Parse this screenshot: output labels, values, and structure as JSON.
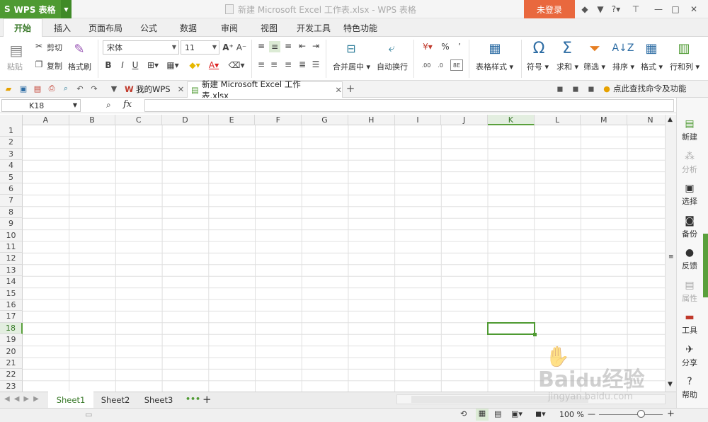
{
  "app": {
    "name": "WPS 表格",
    "logo": "S",
    "window_title": "新建 Microsoft Excel 工作表.xlsx - WPS 表格",
    "login": "未登录"
  },
  "menu_tabs": [
    "开始",
    "插入",
    "页面布局",
    "公式",
    "数据",
    "审阅",
    "视图",
    "开发工具",
    "特色功能"
  ],
  "ribbon": {
    "cut": "剪切",
    "copy": "复制",
    "paste": "粘贴",
    "format_painter": "格式刷",
    "font": "宋体",
    "size": "11",
    "merge_center": "合并居中",
    "wrap": "自动换行",
    "table_style": "表格样式",
    "symbol": "符号",
    "sum": "求和",
    "filter": "筛选",
    "sort": "排序",
    "format": "格式",
    "rowcol": "行和列",
    "percent": "%",
    "comma": "’",
    "bold": "B",
    "italic": "I",
    "underline": "U",
    "font_color": "A"
  },
  "doc_tabs": {
    "my_wps": "我的WPS",
    "current": "新建 Microsoft Excel 工作表.xlsx",
    "help_search": "点此查找命令及功能"
  },
  "formula_bar": {
    "cell_ref": "K18",
    "fx": "fx"
  },
  "grid": {
    "columns": [
      "A",
      "B",
      "C",
      "D",
      "E",
      "F",
      "G",
      "H",
      "I",
      "J",
      "K",
      "L",
      "M",
      "N"
    ],
    "rows": [
      "1",
      "2",
      "3",
      "4",
      "5",
      "6",
      "7",
      "8",
      "9",
      "10",
      "11",
      "12",
      "13",
      "14",
      "15",
      "16",
      "17",
      "18",
      "19",
      "20",
      "21",
      "22",
      "23"
    ],
    "selected_col": "K",
    "selected_row": "18"
  },
  "sheets": [
    "Sheet1",
    "Sheet2",
    "Sheet3"
  ],
  "sheet_more": "•••",
  "sidebar": [
    {
      "label": "新建",
      "icon": "new-doc-icon",
      "enabled": true
    },
    {
      "label": "分析",
      "icon": "analysis-icon",
      "enabled": false
    },
    {
      "label": "选择",
      "icon": "select-icon",
      "enabled": true
    },
    {
      "label": "备份",
      "icon": "backup-icon",
      "enabled": true
    },
    {
      "label": "反馈",
      "icon": "feedback-icon",
      "enabled": true
    },
    {
      "label": "属性",
      "icon": "property-icon",
      "enabled": false
    },
    {
      "label": "工具",
      "icon": "toolbox-icon",
      "enabled": true
    },
    {
      "label": "分享",
      "icon": "share-icon",
      "enabled": true
    },
    {
      "label": "帮助",
      "icon": "help-icon",
      "enabled": true
    }
  ],
  "status": {
    "zoom": "100 %"
  },
  "watermark": {
    "brand": "Baidu经验",
    "url": "jingyan.baidu.com"
  },
  "colors": {
    "brand_green": "#4e9a32",
    "login_orange": "#e9683e"
  }
}
